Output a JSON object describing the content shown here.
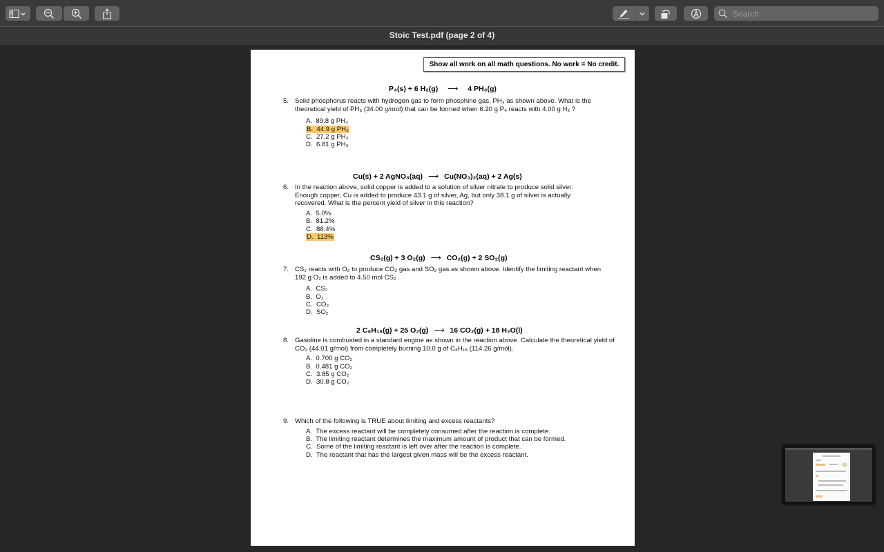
{
  "toolbar": {
    "sidebar_toggle_icon": "sidebar-icon",
    "zoom_out_icon": "zoom-out-icon",
    "zoom_in_icon": "zoom-in-icon",
    "share_icon": "share-icon",
    "markup_icon": "highlighter-icon",
    "rotate_icon": "rotate-icon",
    "annotate_icon": "pen-circle-icon",
    "search_placeholder": "Search"
  },
  "window": {
    "title": "Stoic Test.pdf (page 2 of 4)"
  },
  "document": {
    "notice": "Show all work on all math questions.  No work = No credit.",
    "questions": [
      {
        "number": "5.",
        "equation_html": "P<sub>4</sub>(<i>s</i>)  +  6 H<sub>2</sub>(<i>g</i>)",
        "text": "Solid phosphorus reacts with hydrogen gas to form phosphine gas, PH₃ as shown above.  What is the theoretical yield of PH₃ (34.00 g/mol) that can be formed when 6.20 g P₄ reacts with 4.00 g H₂ ?",
        "options": [
          {
            "letter": "A.",
            "text": "89.8 g PH₃",
            "highlighted": false
          },
          {
            "letter": "B.",
            "text": "44.9 g PH₃",
            "highlighted": true
          },
          {
            "letter": "C.",
            "text": "27.2 g PH₃",
            "highlighted": false
          },
          {
            "letter": "D.",
            "text": "6.81 g PH₃",
            "highlighted": false
          }
        ]
      },
      {
        "number": "6.",
        "text": "In the reaction above, solid copper is added to a solution of silver nitrate to produce solid silver. Enough copper, Cu is added to produce 43.1 g of silver, Ag, but only 38.1 g of silver is actually recovered.  What is the percent yield of silver in this reaction?",
        "options": [
          {
            "letter": "A.",
            "text": "5.0%",
            "highlighted": false
          },
          {
            "letter": "B.",
            "text": "81.2%",
            "highlighted": false
          },
          {
            "letter": "C.",
            "text": "88.4%",
            "highlighted": false
          },
          {
            "letter": "D.",
            "text": "113%",
            "highlighted": true
          }
        ]
      },
      {
        "number": "7.",
        "text": "CS₂ reacts with O₂ to produce CO₂ gas and SO₂ gas as shown above.  Identify the limiting reactant when 192 g O₂ is added to 4.50 mol CS₂ .",
        "options": [
          {
            "letter": "A.",
            "text": "CS₂",
            "highlighted": false
          },
          {
            "letter": "B.",
            "text": "O₂",
            "highlighted": false
          },
          {
            "letter": "C.",
            "text": "CO₂",
            "highlighted": false
          },
          {
            "letter": "D.",
            "text": "SO₂",
            "highlighted": false
          }
        ]
      },
      {
        "number": "8.",
        "text": "Gasoline is combusted in a standard engine as shown in the reaction above. Calculate the theoretical yield of CO₂ (44.01 g/mol) from completely burning 10.0 g of C₈H₁₈ (114.26 g/mol).",
        "options": [
          {
            "letter": "A.",
            "text": "0.700 g CO₂",
            "highlighted": false
          },
          {
            "letter": "B.",
            "text": "0.481 g CO₂",
            "highlighted": false
          },
          {
            "letter": "C.",
            "text": "3.85 g CO₂",
            "highlighted": false
          },
          {
            "letter": "D.",
            "text": "30.8 g CO₂",
            "highlighted": false
          }
        ]
      },
      {
        "number": "9.",
        "text": "Which of the following is TRUE about limiting and excess reactants?",
        "options": [
          {
            "letter": "A.",
            "text": "The excess reactant will be completely consumed after the reaction is complete.",
            "highlighted": false
          },
          {
            "letter": "B.",
            "text": "The limiting reactant determines the maximum amount of product that can be formed.",
            "highlighted": false
          },
          {
            "letter": "C.",
            "text": "Some of the limiting reactant is left over after the reaction is complete.",
            "highlighted": false
          },
          {
            "letter": "D.",
            "text": "The reactant that has the largest given mass will be the excess reactant.",
            "highlighted": false
          }
        ]
      }
    ],
    "equations": {
      "q5_left": "P₄(s)  +  6 H₂(g)",
      "q5_right": "4 PH₃(g)",
      "q6_left": "Cu(s)  +  2 AgNO₃(aq)",
      "q6_right": "Cu(NO₃)₂(aq)  +  2 Ag(s)",
      "q7_left": "CS₂(g)  +  3 O₂(g)",
      "q7_right": "CO₂(g)  +  2 SO₂(g)",
      "q8_left": "2 C₈H₁₈(g)  +  25 O₂(g)",
      "q8_right": "16 CO₂(g)  +  18 H₂O(l)",
      "arrow": "⟶"
    },
    "highlight_color": "#f9c86a"
  },
  "thumbnail": {
    "label": "page-thumbnail-preview"
  }
}
